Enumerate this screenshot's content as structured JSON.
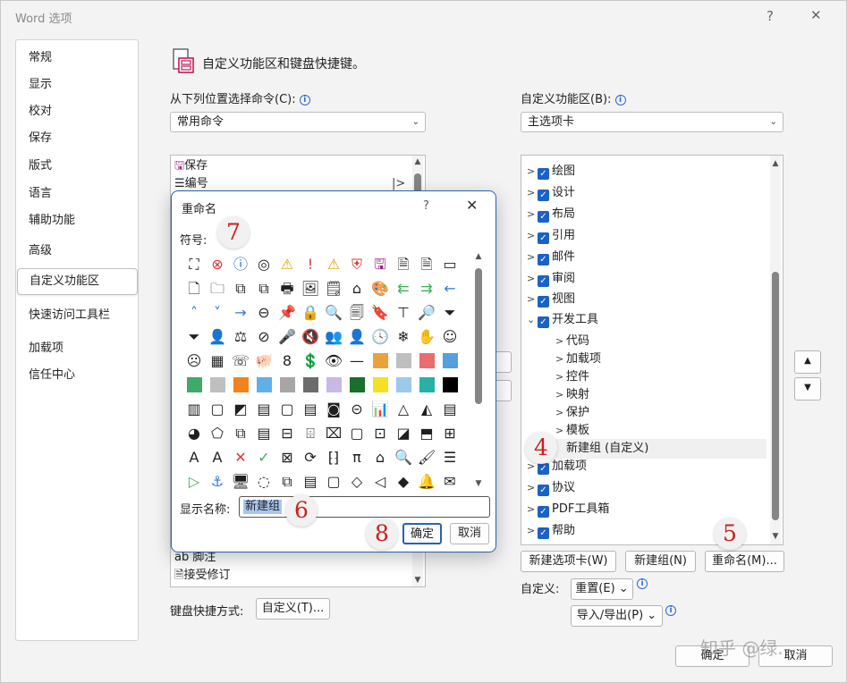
{
  "window": {
    "title": "Word 选项",
    "help": "?",
    "close": "✕"
  },
  "nav": {
    "items": [
      {
        "label": "常规",
        "selected": false
      },
      {
        "label": "显示",
        "selected": false
      },
      {
        "label": "校对",
        "selected": false
      },
      {
        "label": "保存",
        "selected": false
      },
      {
        "label": "版式",
        "selected": false
      },
      {
        "label": "语言",
        "selected": false
      },
      {
        "label": "辅助功能",
        "selected": false
      },
      {
        "label": "高级",
        "selected": false
      },
      {
        "label": "自定义功能区",
        "selected": true
      },
      {
        "label": "快速访问工具栏",
        "selected": false
      },
      {
        "label": "加载项",
        "selected": false
      },
      {
        "label": "信任中心",
        "selected": false
      }
    ]
  },
  "header": {
    "title": "自定义功能区和键盘快捷键。"
  },
  "left": {
    "choose_label": "从下列位置选择命令(C):",
    "choose_value": "常用命令",
    "list_items": [
      "保存",
      "编号"
    ],
    "list_items_bottom": [
      "ab 脚注",
      "接受修订"
    ],
    "keyboard_label": "键盘快捷方式:",
    "keyboard_button": "自定义(T)..."
  },
  "right": {
    "customize_label": "自定义功能区(B):",
    "customize_value": "主选项卡",
    "tree": {
      "top": [
        {
          "label": "绘图",
          "checked": true
        },
        {
          "label": "设计",
          "checked": true
        },
        {
          "label": "布局",
          "checked": true
        },
        {
          "label": "引用",
          "checked": true
        },
        {
          "label": "邮件",
          "checked": true
        },
        {
          "label": "审阅",
          "checked": true
        },
        {
          "label": "视图",
          "checked": true
        },
        {
          "label": "开发工具",
          "checked": true
        }
      ],
      "children": [
        "代码",
        "加载项",
        "控件",
        "映射",
        "保护",
        "模板"
      ],
      "new_group": "新建组 (自定义)",
      "bottom": [
        {
          "label": "加载项",
          "checked": true
        },
        {
          "label": "协议",
          "checked": true
        },
        {
          "label": "PDF工具箱",
          "checked": true
        },
        {
          "label": "帮助",
          "checked": true
        }
      ]
    },
    "btn_new_tab": "新建选项卡(W)",
    "btn_new_group": "新建组(N)",
    "btn_rename": "重命名(M)...",
    "customize_text": "自定义:",
    "reset_button": "重置(E)",
    "import_export_button": "导入/导出(P)"
  },
  "footer": {
    "ok": "确定",
    "cancel": "取消"
  },
  "dialog": {
    "title": "重命名",
    "help": "?",
    "symbol_label": "符号:",
    "symbols": [
      "⛶",
      "⊗",
      "ⓘ",
      "◎",
      "⚠",
      "!",
      "⚠",
      "⛨",
      "🖫",
      "🗎",
      "🗎",
      "▭",
      "🗋",
      "🗀",
      "⧉",
      "⧉",
      "🖶",
      "🖼",
      "🗒",
      "⌂",
      "🎨",
      "⇇",
      "⇉",
      "←",
      "˄",
      "˅",
      "→",
      "⊖",
      "📌",
      "🔒",
      "🔍",
      "🗐",
      "🔖",
      "⊤",
      "🔎",
      "⏷",
      "⏷",
      "👤",
      "⚖",
      "⊘",
      "🎤",
      "🔇",
      "👥",
      "👤",
      "🕓",
      "❄",
      "✋",
      "☺",
      "☹",
      "▦",
      "☏",
      "🐖",
      "8",
      "💲",
      "👁",
      "—",
      "SW:#e8a33b",
      "SW:#bfbfbf",
      "SW:#eb6c6c",
      "SW:#53a0dc",
      "SW:#3faa6b",
      "SW:#bfbfbf",
      "SW:#f0831e",
      "SW:#5fb0e8",
      "SW:#a6a6a6",
      "SW:#6c6c6c",
      "SW:#c7b8e8",
      "SW:#1a6e2e",
      "SW:#f5e025",
      "SW:#9ec8ec",
      "SW:#27b0a6",
      "SW:#000000",
      "▥",
      "▢",
      "◩",
      "▤",
      "▢",
      "▤",
      "◙",
      "⊝",
      "📊",
      "△",
      "◭",
      "▤",
      "◕",
      "⬠",
      "⧉",
      "▤",
      "⊟",
      "⌹",
      "⌧",
      "▢",
      "⊡",
      "◪",
      "⬒",
      "⊞",
      "A",
      "A",
      "✕",
      "✓",
      "⊠",
      "⟳",
      "⁅⁆",
      "π",
      "⌂",
      "🔍",
      "🖌",
      "☰",
      "▷",
      "⚓",
      "🖥",
      "◌",
      "⧉",
      "▤",
      "▢",
      "◇",
      "◁",
      "◆",
      "🔔",
      "✉"
    ],
    "display_label": "显示名称:",
    "display_value": "新建组",
    "ok": "确定",
    "cancel": "取消"
  },
  "badges": {
    "b4": "4",
    "b5": "5",
    "b6": "6",
    "b7": "7",
    "b8": "8"
  },
  "watermark": "知乎 @绿..."
}
